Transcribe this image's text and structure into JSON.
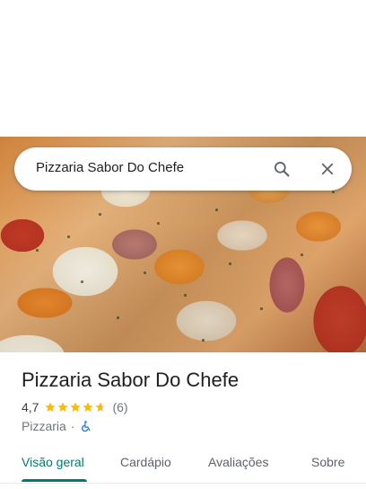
{
  "search": {
    "query": "Pizzaria Sabor Do Chefe",
    "search_icon": "search-icon",
    "close_icon": "close-icon"
  },
  "place": {
    "name": "Pizzaria Sabor Do Chefe",
    "rating": "4,7",
    "rating_value": 4.7,
    "rating_max": 5,
    "review_count": "(6)",
    "category": "Pizzaria",
    "separator": "·",
    "accessibility_icon": "wheelchair-icon"
  },
  "tabs": [
    {
      "label": "Visão geral",
      "active": true
    },
    {
      "label": "Cardápio",
      "active": false
    },
    {
      "label": "Avaliações",
      "active": false
    },
    {
      "label": "Sobre",
      "active": false
    }
  ],
  "colors": {
    "accent": "#01796f",
    "star": "#fbbc04",
    "wheelchair": "#1a73e8"
  }
}
